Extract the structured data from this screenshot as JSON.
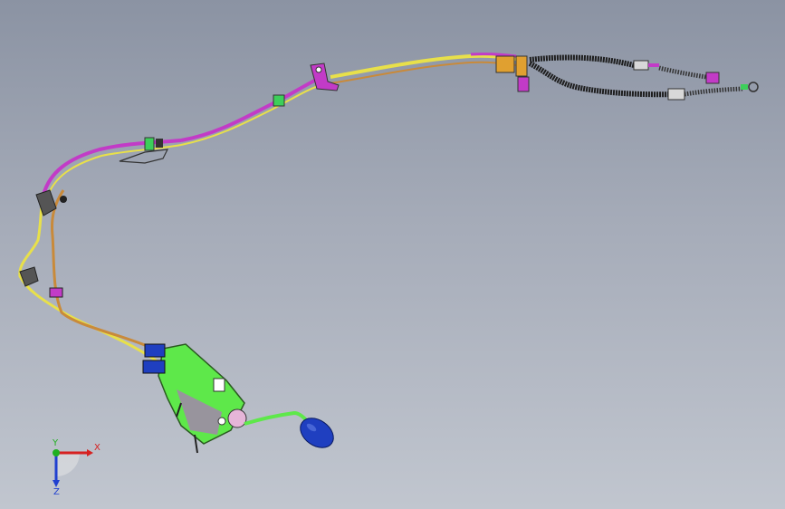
{
  "viewport": {
    "background_top": "#8b93a3",
    "background_bottom": "#c1c6cf"
  },
  "model": {
    "colors": {
      "cable_yellow": "#e8e04a",
      "cable_orange": "#c98a3a",
      "cable_magenta": "#c23bc7",
      "cable_black": "#1e1e1e",
      "bracket_magenta": "#c23bc7",
      "housing_green": "#5ee84a",
      "knob_blue": "#1f3fc0",
      "bracket_orange": "#e0a030",
      "clip_green": "#3ccf5a"
    }
  },
  "triad": {
    "x_label": "X",
    "y_label": "Y",
    "z_label": "Z",
    "x_color": "#d62020",
    "y_color": "#20b020",
    "z_color": "#2040d0"
  }
}
